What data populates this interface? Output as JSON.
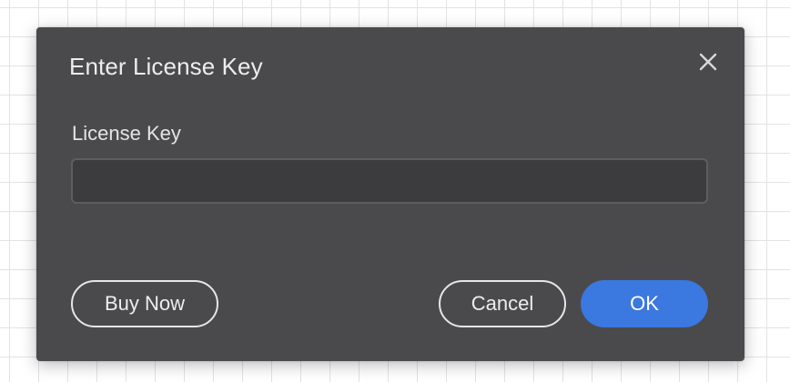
{
  "dialog": {
    "title": "Enter License Key",
    "close_icon": "close-icon",
    "field_label": "License Key",
    "license_key_value": "",
    "buttons": {
      "buy_now": "Buy Now",
      "cancel": "Cancel",
      "ok": "OK"
    }
  },
  "colors": {
    "dialog_background": "#4a4a4c",
    "input_background": "#3c3c3e",
    "primary_button": "#3b78e0",
    "text": "#ededed"
  }
}
